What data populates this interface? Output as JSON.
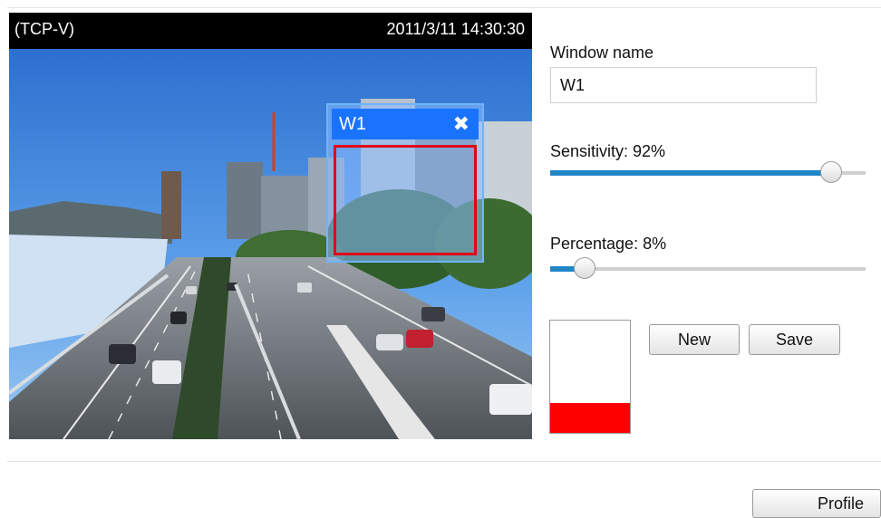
{
  "video": {
    "stream_label": "(TCP-V)",
    "timestamp": "2011/3/11 14:30:30",
    "motion_window": {
      "name": "W1",
      "close_icon": "close-icon"
    }
  },
  "settings": {
    "window_name_label": "Window name",
    "window_name_value": "W1",
    "sensitivity_label": "Sensitivity: 92%",
    "sensitivity_value": 92,
    "percentage_label": "Percentage: 8%",
    "percentage_value": 8,
    "activity_level": 0.27,
    "new_label": "New",
    "save_label": "Save"
  },
  "footer": {
    "profile_label": "Profile"
  },
  "colors": {
    "slider_fill": "#1f86c8",
    "window_title": "#1a73ff",
    "region_border": "#e0001a",
    "activity_bar": "#ff0000"
  }
}
